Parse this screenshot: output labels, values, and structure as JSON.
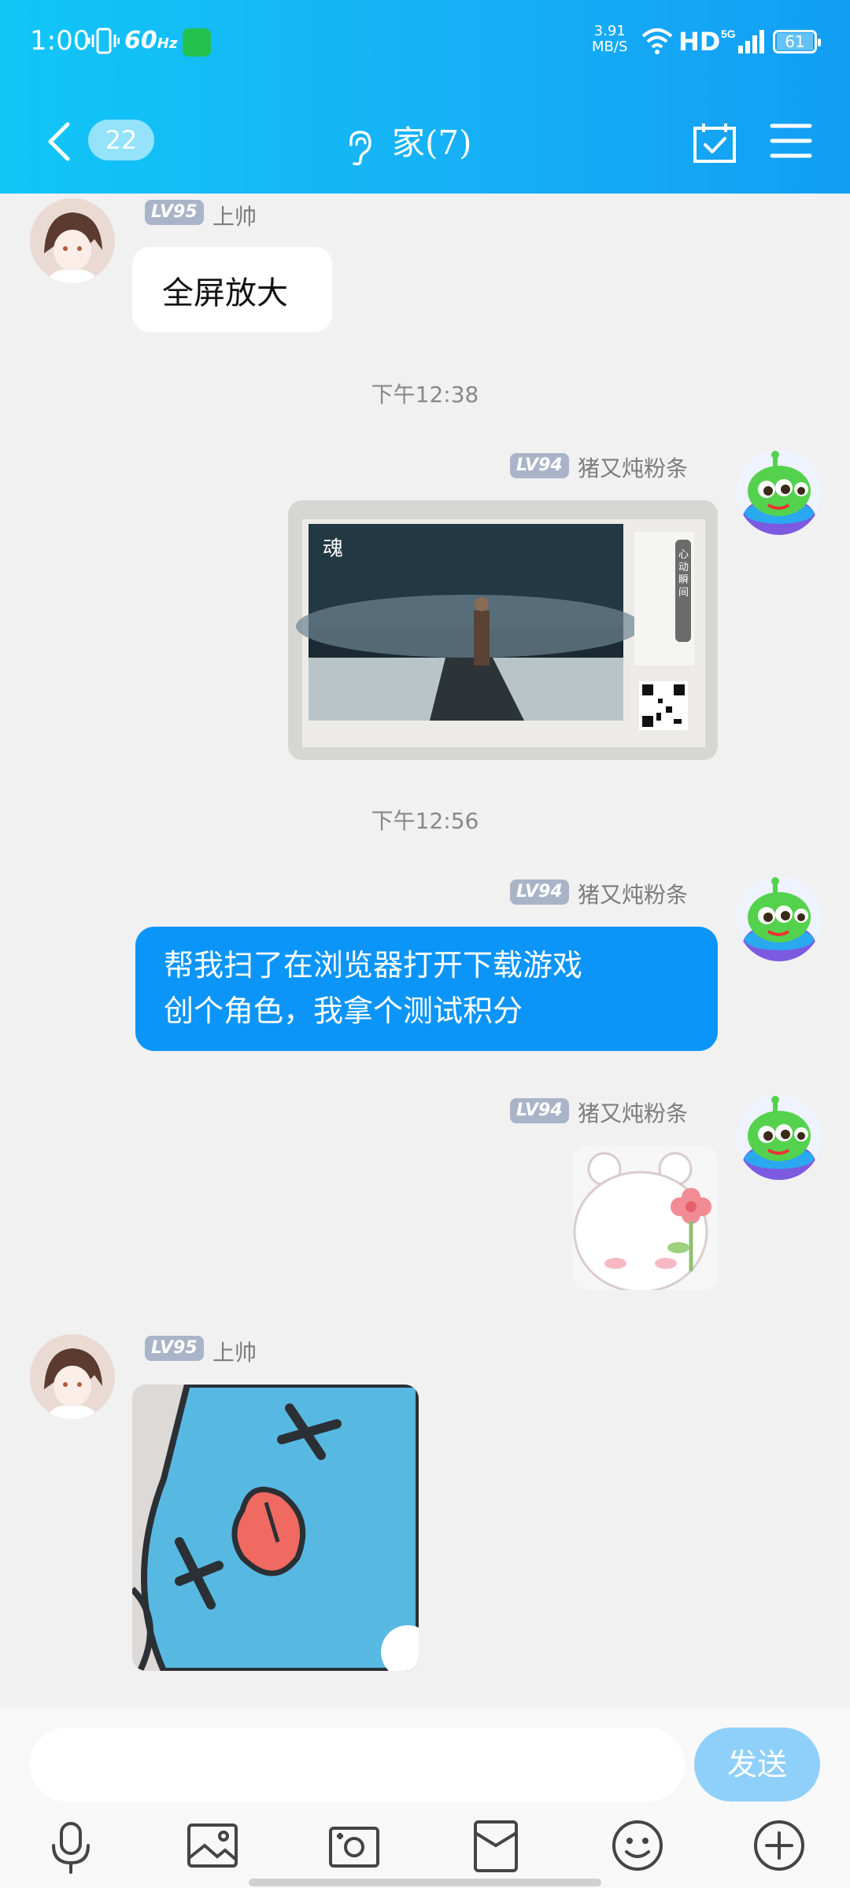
{
  "status_bar": {
    "time": "1:00",
    "refresh": "60",
    "refresh_unit": "Hz",
    "speed_value": "3.91",
    "speed_unit": "MB/S",
    "hd": "HD",
    "network": "5G",
    "battery": "61"
  },
  "header": {
    "unread_count": "22",
    "title": "家(7)",
    "icons": [
      "back-icon",
      "ear-icon",
      "calendar-check-icon",
      "menu-icon"
    ]
  },
  "messages": {
    "m1": {
      "level": "LV95",
      "name": "上帅",
      "text": "全屏放大"
    },
    "t1": "下午12:38",
    "m2": {
      "level": "LV94",
      "name": "猪又炖粉条",
      "image": "game-promo-screenshot",
      "image_text": "心动瞬间"
    },
    "t2": "下午12:56",
    "m3": {
      "level": "LV94",
      "name": "猪又炖粉条",
      "text_line1": "帮我扫了在浏览器打开下载游戏",
      "text_line2": "创个角色，我拿个测试积分"
    },
    "m4": {
      "level": "LV94",
      "name": "猪又炖粉条",
      "image": "bear-flower-sticker"
    },
    "m5": {
      "level": "LV95",
      "name": "上帅",
      "image": "blue-creature-sticker"
    }
  },
  "composer": {
    "send_label": "发送",
    "toolbar_icons": [
      "microphone-icon",
      "image-icon",
      "camera-icon",
      "red-packet-icon",
      "emoji-icon",
      "plus-icon"
    ]
  },
  "colors": {
    "header_gradient_start": "#11c6f7",
    "header_gradient_end": "#129ef3",
    "bubble_blue": "#0c95f8",
    "send_button": "#8fd0fb"
  }
}
